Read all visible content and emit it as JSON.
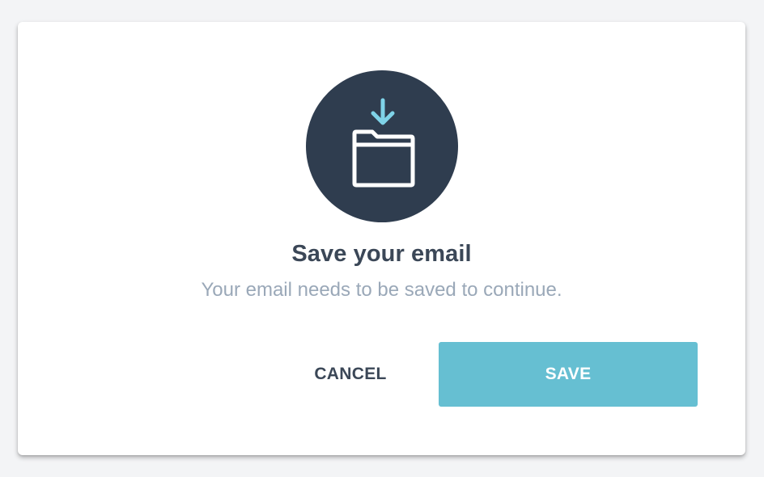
{
  "dialog": {
    "icon": "folder-download-icon",
    "title": "Save your email",
    "subtitle": "Your email needs to be saved to continue.",
    "cancel_label": "CANCEL",
    "save_label": "SAVE"
  },
  "colors": {
    "background": "#f3f4f6",
    "icon_circle": "#2f3d4f",
    "arrow": "#7fd3e8",
    "title": "#3b4757",
    "subtitle": "#9aa8b8",
    "save_button": "#66bfd2",
    "save_text": "#ffffff"
  }
}
